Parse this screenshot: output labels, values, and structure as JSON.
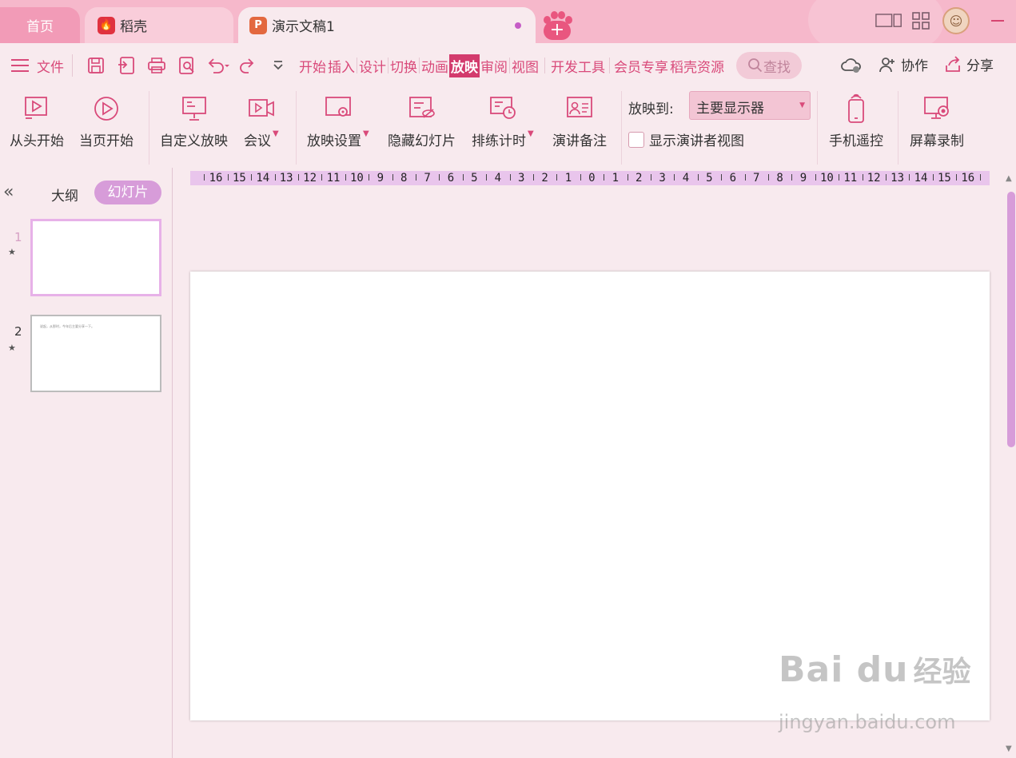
{
  "tabs": {
    "home": "首页",
    "daoke": "稻壳",
    "doc": "演示文稿1",
    "new_tab": "+"
  },
  "menubar": {
    "file": "文件",
    "tabs": [
      "开始",
      "插入",
      "设计",
      "切换",
      "动画",
      "放映",
      "审阅",
      "视图",
      "开发工具",
      "会员专享",
      "稻壳资源"
    ],
    "active_tab": "放映",
    "search": "查找",
    "collab": "协作",
    "share": "分享"
  },
  "ribbon": {
    "buttons": [
      {
        "label": "从头开始",
        "icon": "play-from-start-icon"
      },
      {
        "label": "当页开始",
        "icon": "play-current-icon"
      },
      {
        "label": "自定义放映",
        "icon": "custom-show-icon"
      },
      {
        "label": "会议",
        "icon": "meeting-icon"
      },
      {
        "label": "放映设置",
        "icon": "show-settings-icon"
      },
      {
        "label": "隐藏幻灯片",
        "icon": "hide-slide-icon"
      },
      {
        "label": "排练计时",
        "icon": "rehearse-timing-icon"
      },
      {
        "label": "演讲备注",
        "icon": "speaker-notes-icon"
      },
      {
        "label": "手机遥控",
        "icon": "phone-remote-icon"
      },
      {
        "label": "屏幕录制",
        "icon": "screen-record-icon"
      }
    ],
    "cast_label": "放映到:",
    "cast_value": "主要显示器",
    "presenter_view": "显示演讲者视图",
    "presenter_checked": false
  },
  "leftpane": {
    "outline_tab": "大纲",
    "slides_tab": "幻灯片",
    "slides": [
      {
        "num": "1",
        "star": "★",
        "text": ""
      },
      {
        "num": "2",
        "star": "★",
        "text": "说起，从那时，今年后主要分享一下。"
      }
    ]
  },
  "ruler": {
    "labels": [
      "16",
      "15",
      "14",
      "13",
      "12",
      "11",
      "10",
      "9",
      "8",
      "7",
      "6",
      "5",
      "4",
      "3",
      "2",
      "1",
      "0",
      "1",
      "2",
      "3",
      "4",
      "5",
      "6",
      "7",
      "8",
      "9",
      "10",
      "11",
      "12",
      "13",
      "14",
      "15",
      "16"
    ]
  },
  "watermark": {
    "logo": "Bai du",
    "cn": "经验",
    "url": "jingyan.baidu.com"
  },
  "colors": {
    "accent": "#d94a7a",
    "tabbar": "#f6b8cb",
    "active_tab": "#d33b6d",
    "slides_tab": "#d79cd9"
  }
}
